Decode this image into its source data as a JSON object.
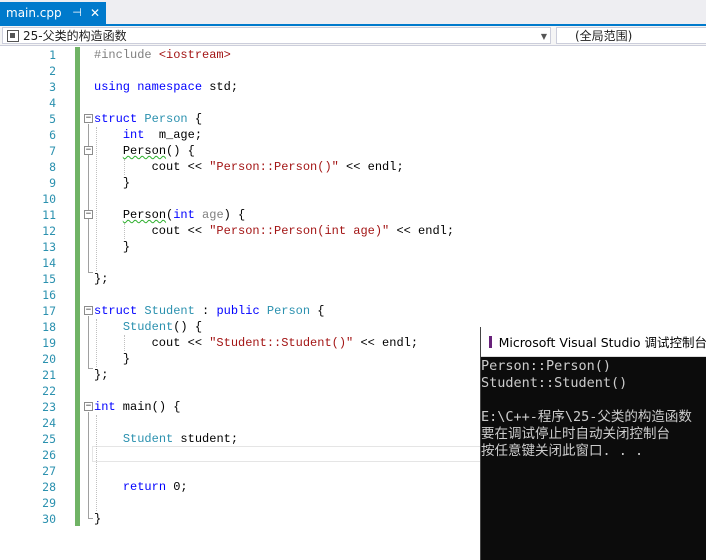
{
  "tab": {
    "title": "main.cpp",
    "pin_glyph": "⊣",
    "close_glyph": "✕"
  },
  "nav": {
    "scope_left": "25-父类的构造函数",
    "scope_right": "(全局范围)"
  },
  "line_numbers": [
    "1",
    "2",
    "3",
    "4",
    "5",
    "6",
    "7",
    "8",
    "9",
    "10",
    "11",
    "12",
    "13",
    "14",
    "15",
    "16",
    "17",
    "18",
    "19",
    "20",
    "21",
    "22",
    "23",
    "24",
    "25",
    "26",
    "27",
    "28",
    "29",
    "30"
  ],
  "code": {
    "l1": {
      "pp": "#include ",
      "hdr": "<iostream>"
    },
    "l3": {
      "kw1": "using",
      "kw2": "namespace",
      "rest": " std;"
    },
    "l5": {
      "kw": "struct",
      "ty": "Person",
      "rest": " {"
    },
    "l6": {
      "kw": "int",
      "rest": "  m_age;"
    },
    "l7": {
      "fn": "Person",
      "rest": "() {"
    },
    "l8": {
      "pre": "cout << ",
      "str": "\"Person::Person()\"",
      "post": " << endl;"
    },
    "l9": "}",
    "l11": {
      "fn": "Person",
      "open": "(",
      "kw": "int",
      "param": " age",
      "rest": ") {"
    },
    "l12": {
      "pre": "cout << ",
      "str": "\"Person::Person(int age)\"",
      "post": " << endl;"
    },
    "l13": "}",
    "l15": "};",
    "l17": {
      "kw1": "struct",
      "ty1": "Student",
      "mid": " : ",
      "kw2": "public",
      "ty2": "Person",
      "rest": " {"
    },
    "l18": {
      "fn": "Student",
      "rest": "() {"
    },
    "l19": {
      "pre": "cout << ",
      "str": "\"Student::Student()\"",
      "post": " << endl;"
    },
    "l20": "}",
    "l21": "};",
    "l23": {
      "kw": "int",
      "rest": " main() {"
    },
    "l25": {
      "ty": "Student",
      "rest": " student;"
    },
    "l28": {
      "kw": "return",
      "rest": " 0;"
    },
    "l30": "}"
  },
  "console": {
    "title": "Microsoft Visual Studio 调试控制台",
    "lines": [
      "Person::Person()",
      "Student::Student()",
      "",
      "E:\\C++-程序\\25-父类的构造函数",
      "要在调试停止时自动关闭控制台",
      "按任意键关闭此窗口. . ."
    ]
  },
  "colors": {
    "accent": "#007acc",
    "keyword": "#0000ff",
    "type": "#2b91af",
    "string": "#a31515",
    "change_bar": "#57a64a"
  }
}
